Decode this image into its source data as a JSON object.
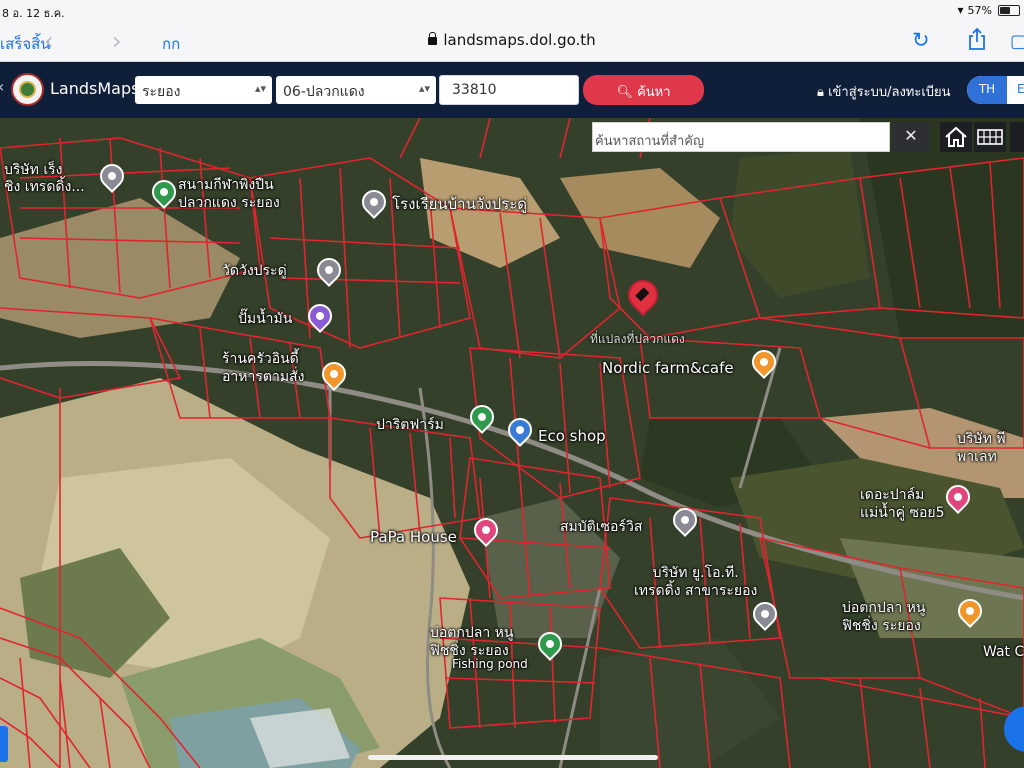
{
  "status_bar": {
    "datetime": "8  อ. 12 ธ.ค.",
    "battery": "57%",
    "battery_level": 0.57
  },
  "browser": {
    "done_label": "เสร็จสิ้น",
    "text_size_label": "กก",
    "url": "landsmaps.dol.go.th"
  },
  "app": {
    "brand": "LandsMaps",
    "province_select": "ระยอง",
    "district_select": "06-ปลวกแดง",
    "parcel_number_value": "33810",
    "search_button": "ค้นหา",
    "login_label": "เข้าสู่ระบบ/ลงทะเบียน",
    "lang_th": "TH",
    "lang_en": "EN",
    "accent_color": "#e0384b",
    "header_color": "#0f1f3a"
  },
  "map": {
    "place_search_placeholder": "ค้นหาสถานที่สำคัญ",
    "clear_icon": "close-icon",
    "labels": {
      "company_top_left": "บริษัท เร็ง\nชิง เทรดดิ้ง...",
      "stadium": "สนามกีฬาพิงปืน\nปลวกแดง ระยอง",
      "school": "โรงเรียนบ้านวังประดู่",
      "temple": "วัดวังประดู่",
      "gas_station": "ปั๊มน้ำมัน",
      "restaurant": "ร้านครัวอินดี้\nอาหารตามสั่ง",
      "pin_caption": "ที่แปลงที่ปลวกแดง",
      "nordic": "Nordic farm&cafe",
      "farm": "ปาริตฟาร์ม",
      "eco_shop": "Eco shop",
      "papa_house": "PaPa House",
      "somboon": "สมบัติเซอร์วิส",
      "company_uoti": "บริษัท ยู.โอ.ที.\nเทรดดิ้ง สาขาระยอง",
      "fishing_pond_th": "บ่อตกปลา หนู\nฟิชชิ่ง ระยอง",
      "fishing_pond_en": "Fishing pond",
      "kapalm": "เดอะปาล์ม\nแม่น้ำคู่ ซอย5",
      "fishing_right": "บ่อตกปลา หนู\nฟิชชิ่ง ระยอง",
      "company_right": "บริษัท พี\nพาเลท",
      "wat_label": "Wat C"
    }
  }
}
